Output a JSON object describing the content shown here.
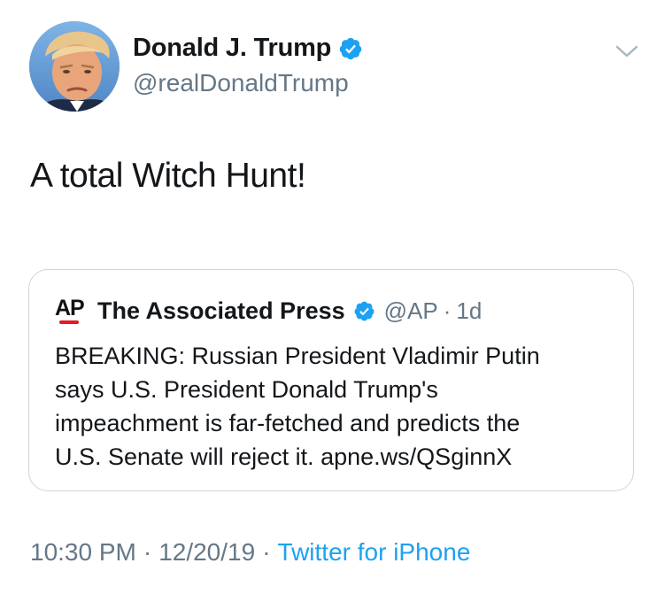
{
  "author": {
    "display_name": "Donald J. Trump",
    "handle": "@realDonaldTrump",
    "verified": true
  },
  "tweet": {
    "text": "A total Witch Hunt!"
  },
  "quoted_tweet": {
    "logo_text": "AP",
    "display_name": "The Associated Press",
    "verified": true,
    "handle": "@AP",
    "separator": "·",
    "time": "1d",
    "text_lines": [
      "BREAKING: Russian President Vladimir Putin",
      "says U.S. President Donald Trump's",
      "impeachment is far-fetched and predicts the",
      "U.S. Senate will reject it. apne.ws/QSginnX"
    ]
  },
  "meta": {
    "time": "10:30 PM",
    "separator": "·",
    "date": "12/20/19",
    "source": "Twitter for iPhone"
  },
  "colors": {
    "verified_blue": "#1da1f2",
    "link_blue": "#1da1f2",
    "muted_gray": "#657786",
    "ap_red": "#e21b23"
  },
  "icons": {
    "verified": "verified-badge-icon",
    "menu": "chevron-down-icon"
  }
}
